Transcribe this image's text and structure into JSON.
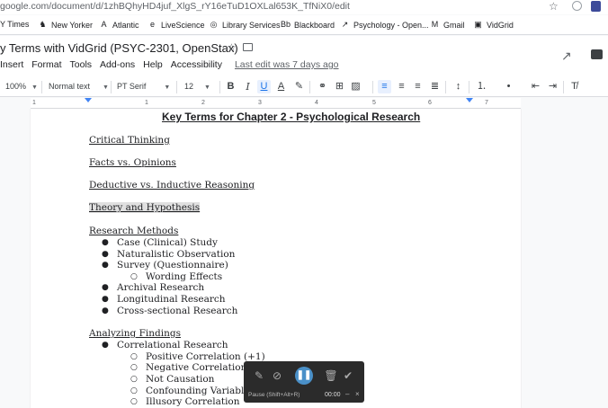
{
  "browser": {
    "url": "google.com/document/d/1zhBQhyHD4juf_XlgS_rY16eTuD1OXLal653K_TfNiX0/edit",
    "bookmarks": [
      {
        "label": "Y Times",
        "icon": "nyt-icon",
        "glyph": "N"
      },
      {
        "label": "New Yorker",
        "icon": "newyorker-icon",
        "glyph": "♞"
      },
      {
        "label": "Atlantic",
        "icon": "atlantic-icon",
        "glyph": "A"
      },
      {
        "label": "LiveScience",
        "icon": "livescience-icon",
        "glyph": "e"
      },
      {
        "label": "Library Services",
        "icon": "globe-icon",
        "glyph": "◎"
      },
      {
        "label": "Blackboard",
        "icon": "blackboard-icon",
        "glyph": "Bb"
      },
      {
        "label": "Psychology - Open...",
        "icon": "psychology-icon",
        "glyph": "↗"
      },
      {
        "label": "Gmail",
        "icon": "gmail-icon",
        "glyph": "M"
      },
      {
        "label": "VidGrid",
        "icon": "vidgrid-icon",
        "glyph": "▣"
      }
    ]
  },
  "doc": {
    "title": "y Terms with VidGrid (PSYC-2301, OpenStax)",
    "menu": [
      "Insert",
      "Format",
      "Tools",
      "Add-ons",
      "Help",
      "Accessibility"
    ],
    "last_edit": "Last edit was 7 days ago"
  },
  "toolbar": {
    "zoom": "100%",
    "style": "Normal text",
    "font": "PT Serif",
    "size": "12"
  },
  "ruler": [
    "1",
    "1",
    "2",
    "3",
    "4",
    "5",
    "6",
    "7"
  ],
  "content": {
    "heading": "Key Terms for Chapter 2 - Psychological Research",
    "lines": [
      {
        "text": "Critical Thinking",
        "style": "u",
        "level": 0
      },
      {
        "text": "Facts vs. Opinions",
        "style": "u",
        "level": 0
      },
      {
        "text": "Deductive vs. Inductive Reasoning",
        "style": "u",
        "level": 0
      },
      {
        "text": "Theory and Hypothesis",
        "style": "u hl",
        "level": 0
      },
      {
        "text": "Research Methods",
        "style": "u",
        "level": 0
      },
      {
        "text": "Case (Clinical) Study",
        "style": "",
        "level": 1
      },
      {
        "text": "Naturalistic Observation",
        "style": "",
        "level": 1
      },
      {
        "text": "Survey (Questionnaire)",
        "style": "",
        "level": 1
      },
      {
        "text": "Wording Effects",
        "style": "",
        "level": 2
      },
      {
        "text": "Archival Research",
        "style": "",
        "level": 1
      },
      {
        "text": "Longitudinal Research",
        "style": "",
        "level": 1
      },
      {
        "text": "Cross-sectional Research",
        "style": "",
        "level": 1
      },
      {
        "text": "Analyzing Findings",
        "style": "u",
        "level": 0
      },
      {
        "text": "Correlational Research",
        "style": "",
        "level": 1
      },
      {
        "text": "Positive Correlation (+1)",
        "style": "",
        "level": 2
      },
      {
        "text": "Negative Correlation (-",
        "style": "",
        "level": 2
      },
      {
        "text": "Not Causation",
        "style": "",
        "level": 2
      },
      {
        "text": "Confounding Variable",
        "style": "",
        "level": 2
      },
      {
        "text": "Illusory Correlation",
        "style": "",
        "level": 2
      }
    ]
  },
  "recorder": {
    "hint": "Pause (Shift+Alt+R)",
    "time": "00:00",
    "minimize": "–",
    "close": "×",
    "pause_glyph": "❚❚"
  }
}
